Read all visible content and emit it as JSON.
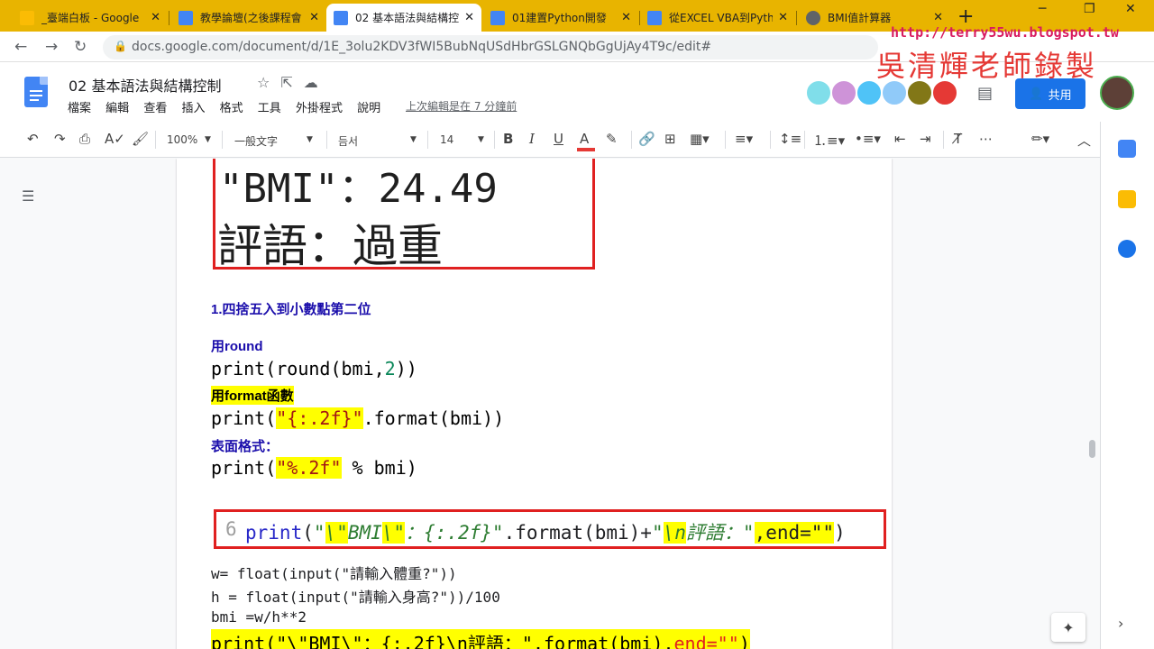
{
  "browser": {
    "tabs": [
      {
        "title": "_臺端白板 - Google",
        "icon": "google-drive-icon",
        "color": "#fbbc04"
      },
      {
        "title": "教學論壇(之後課程會",
        "icon": "google-docs-icon",
        "color": "#4285f4"
      },
      {
        "title": "02 基本語法與結構控",
        "icon": "google-docs-icon",
        "color": "#4285f4",
        "active": true
      },
      {
        "title": "01建置Python開發",
        "icon": "google-docs-icon",
        "color": "#4285f4"
      },
      {
        "title": "從EXCEL VBA到Pyth",
        "icon": "google-docs-icon",
        "color": "#4285f4"
      },
      {
        "title": "BMI值計算器",
        "icon": "globe-icon",
        "color": "#5f6368"
      }
    ],
    "new_tab": "+",
    "url": "docs.google.com/document/d/1E_3olu2KDV3fWI5BubNqUSdHbrGSLGNQbGgUjAy4T9c/edit#"
  },
  "watermark": {
    "blog_url": "http://terry55wu.blogspot.tw",
    "author": "吳清輝老師錄製"
  },
  "doc": {
    "title": "02 基本語法與結構控制",
    "menu": [
      "檔案",
      "編輯",
      "查看",
      "插入",
      "格式",
      "工具",
      "外掛程式",
      "說明"
    ],
    "last_edit": "上次編輯是在 7 分鐘前",
    "share_label": "共用"
  },
  "toolbar": {
    "zoom": "100%",
    "style": "一般文字",
    "font": "듬서",
    "size": "14"
  },
  "content": {
    "result_bmi": "\"BMI\"：24.49",
    "result_comment": "評語：過重",
    "heading_round_to_2": "1.四捨五入到小數點第二位",
    "label_round": "用round",
    "code_round": {
      "a": "print(round(bmi,",
      "num": "2",
      "b": "))"
    },
    "label_format": "用format函數",
    "code_format": {
      "a": "print(",
      "str": "\"{:.2f}\"",
      "b": ".format(bmi))"
    },
    "label_surface": "表面格式：",
    "code_percent": {
      "a": "print(",
      "str": "\"%.2f\"",
      "b": " % bmi)"
    },
    "snippet": {
      "line_no": "6",
      "print": "print",
      "p1": "(",
      "q1": "\"",
      "esc1": "\\\"",
      "bmi": "BMI",
      "esc2": "\\\"",
      "fmt": "：{:.2f}\"",
      "mid": ".format(bmi)+",
      "q2": "\"",
      "esc3": "\\n",
      "cmt": "評語：\"",
      "end": ",end=\"\"",
      "close": ")"
    },
    "line_w": "w= float(input(\"請輸入體重?\"))",
    "line_h": "h = float(input(\"請輸入身高?\"))/100",
    "line_bmi": "bmi =w/h**2",
    "line_final_a": "print(\"\\\"BMI\\\"：{:.2f}\\n評語：\".format(bmi),",
    "line_final_red": "end=\"\"",
    "line_final_b": ")"
  }
}
